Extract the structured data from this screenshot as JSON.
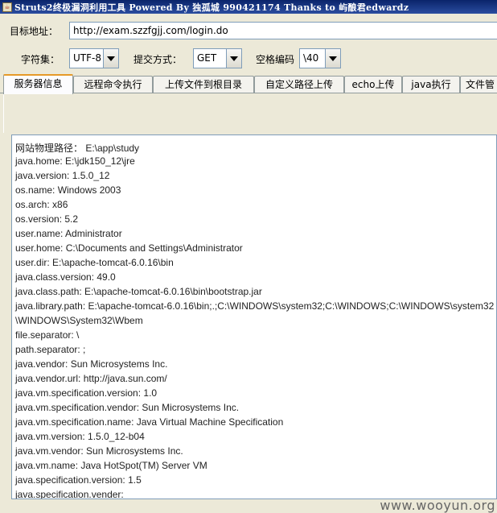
{
  "window": {
    "title": "Struts2终极漏洞利用工具   Powered By 独孤城 990421174 Thanks to 屿酿君edwardz",
    "icon": "java-app-icon"
  },
  "form": {
    "target_label": "目标地址：",
    "target_value": "http://exam.szzfgjj.com/login.do",
    "charset_label": "字符集：",
    "charset_value": "UTF-8",
    "method_label": "提交方式：",
    "method_value": "GET",
    "space_label": "空格编码",
    "space_value": "\\40"
  },
  "tabs": [
    {
      "label": "服务器信息",
      "active": true
    },
    {
      "label": "远程命令执行"
    },
    {
      "label": "上传文件到根目录"
    },
    {
      "label": "自定义路径上传"
    },
    {
      "label": "echo上传"
    },
    {
      "label": "java执行"
    },
    {
      "label": "文件管"
    }
  ],
  "output_lines": [
    "网站物理路径： E:\\app\\study",
    "java.home: E:\\jdk150_12\\jre",
    "java.version: 1.5.0_12",
    "os.name: Windows 2003",
    "os.arch: x86",
    "os.version: 5.2",
    "user.name: Administrator",
    "user.home: C:\\Documents and Settings\\Administrator",
    "user.dir: E:\\apache-tomcat-6.0.16\\bin",
    "java.class.version: 49.0",
    "java.class.path: E:\\apache-tomcat-6.0.16\\bin\\bootstrap.jar",
    "java.library.path: E:\\apache-tomcat-6.0.16\\bin;.;C:\\WINDOWS\\system32;C:\\WINDOWS;C:\\WINDOWS\\system32",
    "\\WINDOWS\\System32\\Wbem",
    "file.separator: \\",
    "path.separator: ;",
    "java.vendor: Sun Microsystems Inc.",
    "java.vendor.url: http://java.sun.com/",
    "java.vm.specification.version: 1.0",
    "java.vm.specification.vendor: Sun Microsystems Inc.",
    "java.vm.specification.name: Java Virtual Machine Specification",
    "java.vm.version: 1.5.0_12-b04",
    "java.vm.vendor: Sun Microsystems Inc.",
    "java.vm.name: Java HotSpot(TM) Server VM",
    "java.specification.version: 1.5",
    "java.specification.vender:"
  ],
  "watermark": "www.wooyun.org"
}
